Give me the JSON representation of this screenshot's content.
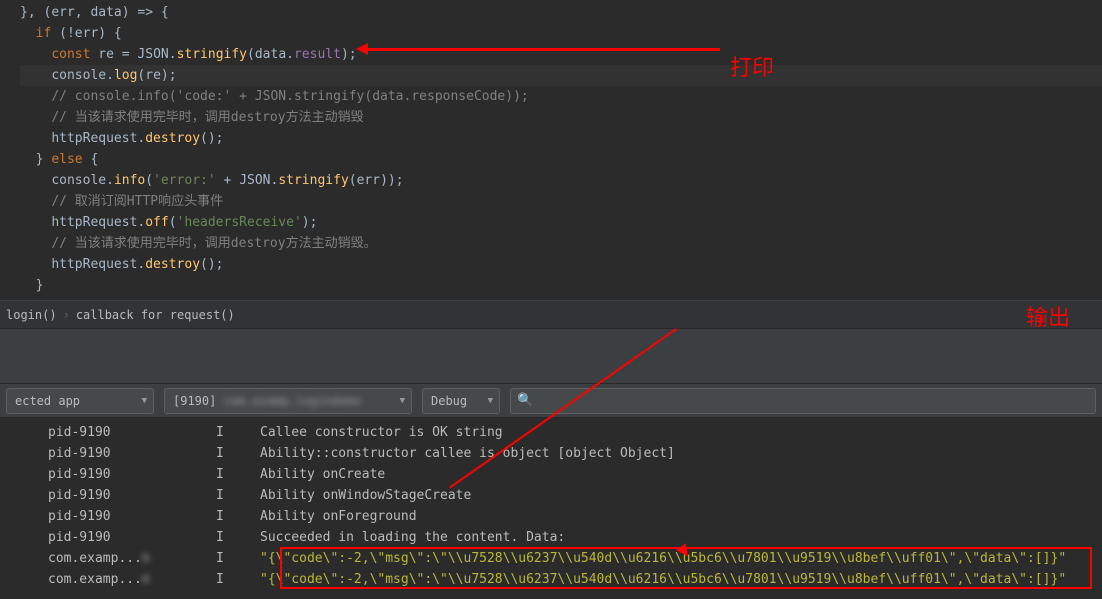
{
  "annotations": {
    "print": "打印",
    "output": "输出"
  },
  "code": {
    "l0": {
      "p0": "},",
      "p1": " (",
      "p2": "err",
      "p3": ", ",
      "p4": "data",
      "p5": ") => {"
    },
    "l1": {
      "p0": "if",
      "p1": " (!",
      "p2": "err",
      "p3": ") {"
    },
    "l2": {
      "p0": "const ",
      "p1": "re",
      "p2": " = ",
      "p3": "JSON",
      "p4": ".",
      "p5": "stringify",
      "p6": "(",
      "p7": "data",
      "p8": ".",
      "p9": "result",
      "p10": ");"
    },
    "l3": {
      "p0": "console",
      "p1": ".",
      "p2": "log",
      "p3": "(",
      "p4": "re",
      "p5": ");"
    },
    "l4": "// console.info('code:' + JSON.stringify(data.responseCode));",
    "l5": "// 当该请求使用完毕时，调用destroy方法主动销毁",
    "l6": {
      "p0": "httpRequest",
      "p1": ".",
      "p2": "destroy",
      "p3": "();"
    },
    "l7": {
      "p0": "} ",
      "p1": "else",
      "p2": " {"
    },
    "l8": {
      "p0": "console",
      "p1": ".",
      "p2": "info",
      "p3": "(",
      "p4": "'error:'",
      "p5": " + ",
      "p6": "JSON",
      "p7": ".",
      "p8": "stringify",
      "p9": "(",
      "p10": "err",
      "p11": "));"
    },
    "l9": "// 取消订阅HTTP响应头事件",
    "l10": {
      "p0": "httpRequest",
      "p1": ".",
      "p2": "off",
      "p3": "(",
      "p4": "'headersReceive'",
      "p5": ");"
    },
    "l11": "// 当该请求使用完毕时，调用destroy方法主动销毁。",
    "l12": {
      "p0": "httpRequest",
      "p1": ".",
      "p2": "destroy",
      "p3": "();"
    },
    "l13": "}",
    "l14": "}"
  },
  "breadcrumb": {
    "item0": "login()",
    "sep": "›",
    "item1": "callback for request()"
  },
  "toolbar": {
    "app": "ected app",
    "process": "[9190]",
    "process_blur": "com.examp.logindemo",
    "level": "Debug",
    "search_placeholder": ""
  },
  "logs": [
    {
      "tag": "pid-9190",
      "lvl": "I",
      "msg": "Callee constructor is OK string",
      "warn": false
    },
    {
      "tag": "pid-9190",
      "lvl": "I",
      "msg": "Ability::constructor callee is object [object Object]",
      "warn": false
    },
    {
      "tag": "pid-9190",
      "lvl": "I",
      "msg": "Ability onCreate",
      "warn": false
    },
    {
      "tag": "pid-9190",
      "lvl": "I",
      "msg": "Ability onWindowStageCreate",
      "warn": false
    },
    {
      "tag": "pid-9190",
      "lvl": "I",
      "msg": "Ability onForeground",
      "warn": false
    },
    {
      "tag": "pid-9190",
      "lvl": "I",
      "msg": "Succeeded in loading the content. Data:",
      "warn": false
    },
    {
      "tag": "com.examp...",
      "lvl": "I",
      "msg": "\"{\\\"code\\\":-2,\\\"msg\\\":\\\"\\\\u7528\\\\u6237\\\\u540d\\\\u6216\\\\u5bc6\\\\u7801\\\\u9519\\\\u8bef\\\\uff01\\\",\\\"data\\\":[]}\"",
      "warn": true,
      "blur": true
    },
    {
      "tag": "com.examp...",
      "lvl": "I",
      "msg": "\"{\\\"code\\\":-2,\\\"msg\\\":\\\"\\\\u7528\\\\u6237\\\\u540d\\\\u6216\\\\u5bc6\\\\u7801\\\\u9519\\\\u8bef\\\\uff01\\\",\\\"data\\\":[]}\"",
      "warn": true,
      "blur": true
    }
  ]
}
